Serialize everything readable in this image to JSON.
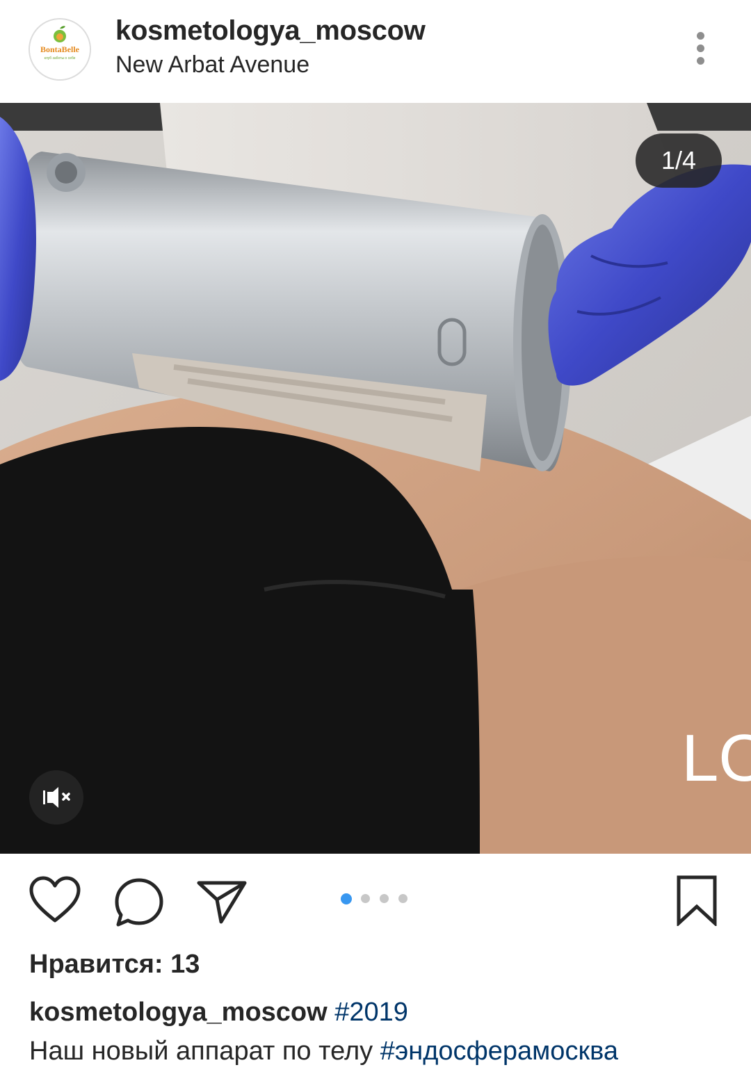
{
  "post": {
    "username": "kosmetologya_moscow",
    "location": "New Arbat Avenue",
    "avatar_brand": "BontaBelle",
    "avatar_tagline": "клуб заботы о себе",
    "counter": "1/4",
    "overlay_text": "LO",
    "likes_label": "Нравится: 13",
    "caption_user": "kosmetologya_moscow",
    "caption_hashtag_1": "#2019",
    "caption_text": "Наш новый аппарат по телу",
    "caption_hashtag_2": "#эндосферамосква"
  },
  "carousel": {
    "total": 4,
    "current": 1
  },
  "icons": {
    "more": "more-vertical-icon",
    "like": "heart-icon",
    "comment": "comment-icon",
    "share": "send-icon",
    "save": "bookmark-icon",
    "mute": "muted-speaker-icon"
  },
  "colors": {
    "accent": "#3897f0",
    "hashtag": "#003569",
    "text": "#262626",
    "muted": "#8e8e8e"
  }
}
